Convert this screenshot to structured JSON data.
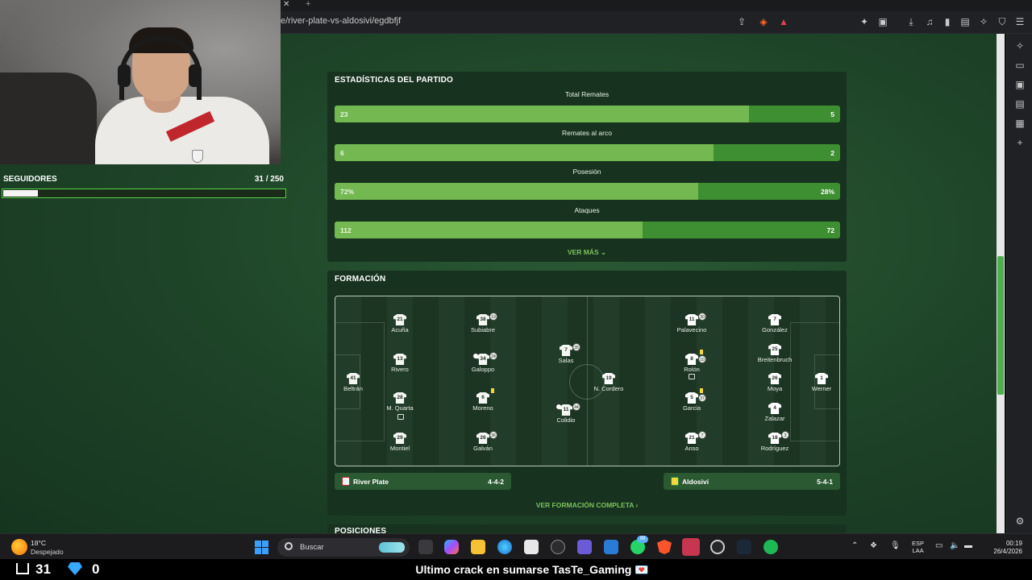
{
  "browser": {
    "url": "e/river-plate-vs-aldosivi/egdbfjf"
  },
  "stats": {
    "title": "ESTADÍSTICAS DEL PARTIDO",
    "items": [
      {
        "label": "Total Remates",
        "left": "23",
        "right": "5",
        "left_share": 0.82
      },
      {
        "label": "Remates al arco",
        "left": "6",
        "right": "2",
        "left_share": 0.75
      },
      {
        "label": "Posesión",
        "left": "72%",
        "right": "28%",
        "left_share": 0.72
      },
      {
        "label": "Ataques",
        "left": "112",
        "right": "72",
        "left_share": 0.61
      }
    ],
    "more": "VER MÁS ⌄"
  },
  "formation": {
    "title": "FORMACIÓN",
    "home_players": [
      {
        "num": "41",
        "name": "Beltrán"
      },
      {
        "num": "21",
        "name": "Acuña"
      },
      {
        "num": "13",
        "name": "Rivero"
      },
      {
        "num": "28",
        "name": "M. Quarta"
      },
      {
        "num": "29",
        "name": "Montiel"
      },
      {
        "num": "38",
        "name": "Subiabre",
        "sub": "19"
      },
      {
        "num": "34",
        "name": "Galoppo",
        "sub": "24"
      },
      {
        "num": "6",
        "name": "Moreno"
      },
      {
        "num": "26",
        "name": "Galván",
        "sub": "36"
      },
      {
        "num": "7",
        "name": "Salas",
        "sub": "35"
      },
      {
        "num": "11",
        "name": "Colidio",
        "sub": "44"
      }
    ],
    "away_players": [
      {
        "num": "19",
        "name": "N. Cordero"
      },
      {
        "num": "11",
        "name": "Palavecino",
        "sub": "30"
      },
      {
        "num": "8",
        "name": "Rolón",
        "sub": "10"
      },
      {
        "num": "5",
        "name": "Garcia",
        "sub": "37"
      },
      {
        "num": "21",
        "name": "Anso",
        "sub": "7"
      },
      {
        "num": "7",
        "name": "González"
      },
      {
        "num": "25",
        "name": "Breitenbruch"
      },
      {
        "num": "26",
        "name": "Moya"
      },
      {
        "num": "4",
        "name": "Zalazar"
      },
      {
        "num": "18",
        "name": "Rodríguez",
        "sub": "3"
      },
      {
        "num": "1",
        "name": "Werner"
      }
    ],
    "home_team": {
      "name": "River Plate",
      "formation": "4-4-2"
    },
    "away_team": {
      "name": "Aldosivi",
      "formation": "5-4-1"
    },
    "full_link": "VER FORMACIÓN COMPLETA ›",
    "next_section": "POSICIONES"
  },
  "overlay": {
    "followers_label": "SEGUIDORES",
    "followers_count": "31 / 250",
    "followers_progress": 0.124
  },
  "taskbar": {
    "temp": "18°C",
    "condition": "Despejado",
    "search": "Buscar",
    "lang1": "ESP",
    "lang2": "LAA",
    "time": "00:19",
    "date": "26/4/2026",
    "chat_badge": "99"
  },
  "streambar": {
    "mail_count": "31",
    "gem_count": "0",
    "message": "Ultimo crack en sumarse TasTe_Gaming 💌"
  },
  "colors": {
    "bar_left": "#74b852",
    "bar_right": "#3e8e32",
    "accent": "#7cc35b"
  }
}
